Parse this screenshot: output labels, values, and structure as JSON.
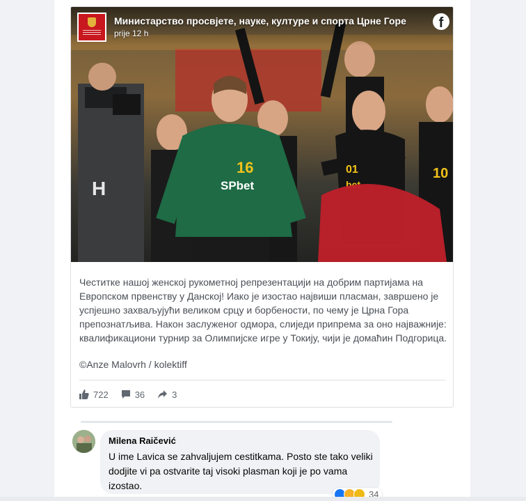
{
  "post": {
    "page_name": "Министарство просвјете, науке, културе и спорта Црне Горе",
    "time": "prije 12 h",
    "platform_icon": "facebook-icon",
    "text": "Честитке нашој женској рукометној репрезентацији на добрим партијама на Европском првенству у Данској! Иако је изостао највиши пласман, завршено је успјешно захваљујући великом срцу и борбености, по чему је Црна Гора препознатљива. Након заслуженог одмора, слиједи припрема за оно најважније: квалификациони турнир за Олимпијске игре у Токију, чији је домаћин Подгорица.",
    "photo_credit": "©Anze Malovrh / kolektiff",
    "stats": {
      "likes": "722",
      "comments": "36",
      "shares": "3"
    },
    "image": {
      "jersey_number": "16",
      "jersey_sponsor": "SPbet"
    }
  },
  "comment": {
    "author": "Milena Raičević",
    "text": "U ime Lavica se zahvaljujem cestitkama. Posto ste tako veliki dodjite vi pa ostvarite taj visoki plasman koji je po vama izostao.",
    "reaction_count": "34"
  },
  "colors": {
    "page_bg": "#f0f2f5",
    "avatar_red": "#c8171e",
    "jersey_green": "#1e6b45",
    "like_blue": "#1877f2"
  }
}
